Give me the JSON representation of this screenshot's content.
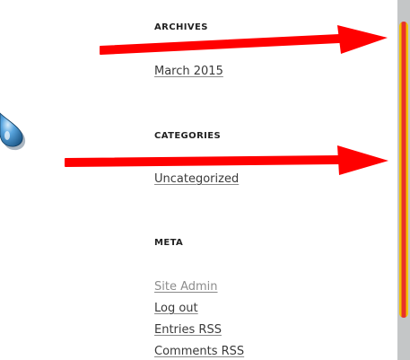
{
  "sidebar": {
    "archives": {
      "title": "ARCHIVES",
      "links": [
        "March 2015"
      ]
    },
    "categories": {
      "title": "CATEGORIES",
      "links": [
        "Uncategorized"
      ]
    },
    "meta": {
      "title": "META",
      "links": [
        "Site Admin",
        "Log out",
        "Entries RSS",
        "Comments RSS"
      ]
    }
  },
  "colors": {
    "annotation_arrow": "#ff0000",
    "scrollbar_thumb": "#f2c200",
    "scrollbar_track": "#c4c6c7",
    "droplet": "#2f7fc1"
  },
  "icons": {
    "droplet": "water-droplet-icon",
    "arrows": "red-arrow-annotation"
  }
}
